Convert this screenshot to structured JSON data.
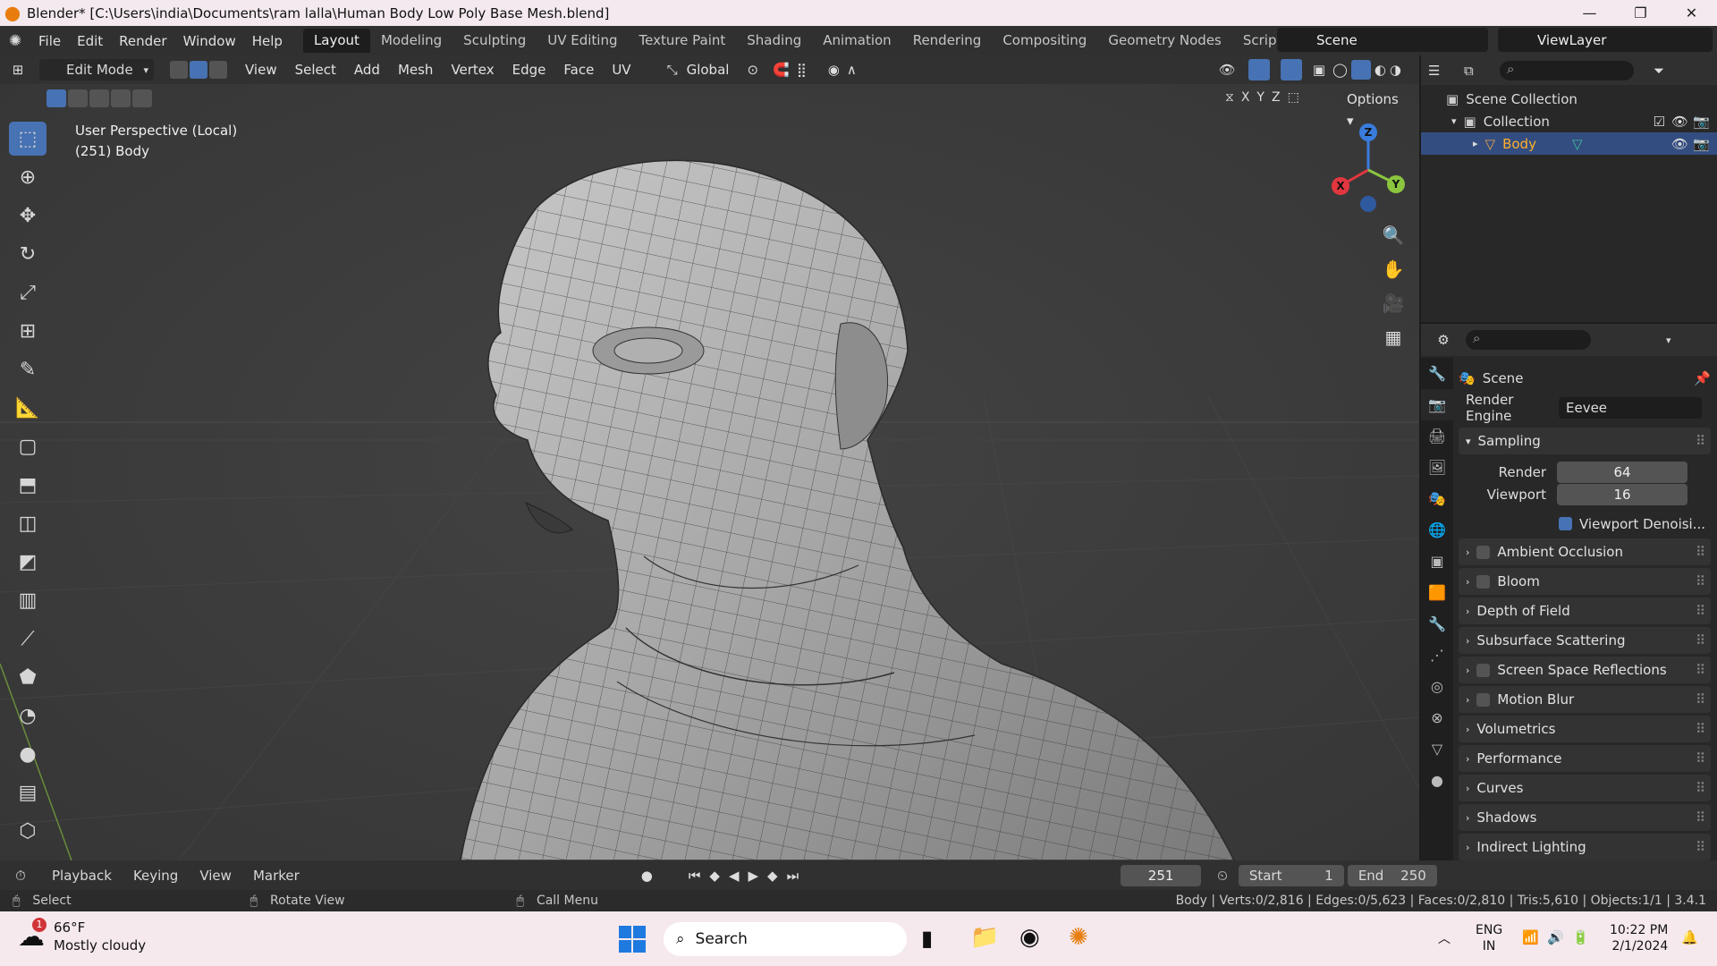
{
  "window": {
    "title": "Blender* [C:\\Users\\india\\Documents\\ram lalla\\Human Body Low Poly Base Mesh.blend]"
  },
  "menu": [
    "File",
    "Edit",
    "Render",
    "Window",
    "Help"
  ],
  "workspaces": [
    "Layout",
    "Modeling",
    "Sculpting",
    "UV Editing",
    "Texture Paint",
    "Shading",
    "Animation",
    "Rendering",
    "Compositing",
    "Geometry Nodes",
    "Scripting"
  ],
  "active_workspace": "Layout",
  "scene": {
    "name": "Scene",
    "view_layer": "ViewLayer"
  },
  "viewport": {
    "mode": "Edit Mode",
    "menus": [
      "View",
      "Select",
      "Add",
      "Mesh",
      "Vertex",
      "Edge",
      "Face",
      "UV"
    ],
    "orientation": "Global",
    "options_label": "Options",
    "axes": [
      "X",
      "Y",
      "Z"
    ],
    "info_line1": "User Perspective (Local)",
    "info_line2": "(251) Body",
    "gizmo": {
      "x": "X",
      "y": "Y",
      "z": "Z",
      "x_color": "#e2363f",
      "y_color": "#8bc53f",
      "z_color": "#3a7cdd"
    }
  },
  "tools": [
    "select-box",
    "cursor",
    "move",
    "rotate",
    "scale",
    "transform",
    "annotate",
    "measure",
    "add-cube",
    "extrude",
    "inset",
    "bevel",
    "loop-cut",
    "knife",
    "poly-build",
    "spin",
    "smooth",
    "edge-slide",
    "shrink"
  ],
  "outliner": {
    "root": "Scene Collection",
    "collection": "Collection",
    "object": "Body"
  },
  "properties": {
    "context": "Scene",
    "render_engine_label": "Render Engine",
    "render_engine": "Eevee",
    "sampling": {
      "label": "Sampling",
      "render_label": "Render",
      "render": "64",
      "viewport_label": "Viewport",
      "viewport": "16",
      "denoise": "Viewport Denoisi..."
    },
    "sections": [
      {
        "label": "Ambient Occlusion",
        "checkbox": true
      },
      {
        "label": "Bloom",
        "checkbox": true
      },
      {
        "label": "Depth of Field",
        "checkbox": false
      },
      {
        "label": "Subsurface Scattering",
        "checkbox": false
      },
      {
        "label": "Screen Space Reflections",
        "checkbox": true
      },
      {
        "label": "Motion Blur",
        "checkbox": true
      },
      {
        "label": "Volumetrics",
        "checkbox": false
      },
      {
        "label": "Performance",
        "checkbox": false
      },
      {
        "label": "Curves",
        "checkbox": false
      },
      {
        "label": "Shadows",
        "checkbox": false
      },
      {
        "label": "Indirect Lighting",
        "checkbox": false
      }
    ]
  },
  "timeline": {
    "menus": [
      "Playback",
      "Keying",
      "View",
      "Marker"
    ],
    "current": "251",
    "start_label": "Start",
    "start": "1",
    "end_label": "End",
    "end": "250"
  },
  "status": {
    "select": "Select",
    "rotate": "Rotate View",
    "call": "Call Menu",
    "stats": "Body | Verts:0/2,816 | Edges:0/5,623 | Faces:0/2,810 | Tris:5,610 | Objects:1/1 | 3.4.1"
  },
  "taskbar": {
    "weather_temp": "66°F",
    "weather_desc": "Mostly cloudy",
    "weather_badge": "1",
    "search": "Search",
    "lang1": "ENG",
    "lang2": "IN",
    "time": "10:22 PM",
    "date": "2/1/2024"
  },
  "colors": {
    "accent": "#4772b3",
    "bg": "#3d3d3d",
    "panel": "#282828",
    "blender_orange": "#e87d0d"
  }
}
